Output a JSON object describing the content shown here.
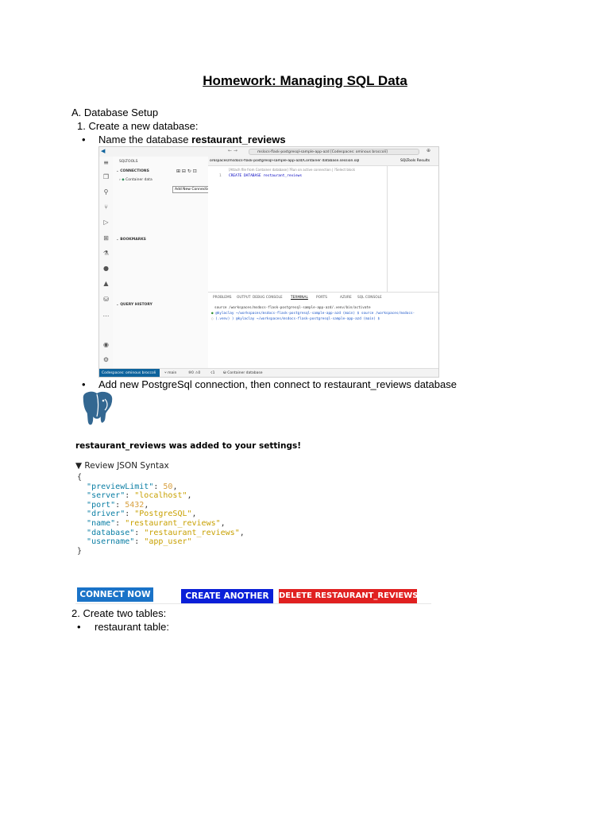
{
  "doc": {
    "title": "Homework: Managing SQL Data",
    "section_a": "A.  Database Setup",
    "step1": "1.  Create a new database:",
    "bullet1_prefix": "Name the database ",
    "bullet1_bold": "restaurant_reviews",
    "bullet2": "Add new PostgreSql connection, then connect to restaurant_reviews database",
    "step2": "2.   Create two tables:",
    "bullet3": "restaurant table:"
  },
  "vscode": {
    "search_text": "mslocs-flask-postgresql-sample-app-azd [Codespaces: ominous broccoli]",
    "sidebar": {
      "title": "SQLTOOLS",
      "connections": "CONNECTIONS",
      "container_db": "Container data",
      "tooltip": "Add New Connection",
      "bookmarks": "BOOKMARKS",
      "query_history": "QUERY HISTORY"
    },
    "editor": {
      "tab_path": "orkspaces/msdocs-flask-postgresql-sample-app-azd/Container database.session.sql",
      "results_tab": "SQLTools Results",
      "hint": "[Attach file from Container database] ?Run on active connection | ?Select block",
      "line_no": "1",
      "code": "CREATE DATABASE restaurant_reviews"
    },
    "panel": {
      "tabs": [
        "PROBLEMS",
        "OUTPUT",
        "DEBUG CONSOLE",
        "TERMINAL",
        "PORTS",
        "AZURE",
        "SQL CONSOLE"
      ],
      "line1": "source /workspaces/msdocs-flask-postgresql-sample-app-azd/.venv/bin/activate",
      "line2": "@kylaclay →/workspaces/msdocs-flask-postgresql-sample-app-azd (main) $ source /workspaces/msdocs-",
      "line3": "(.venv) ) @kylaclay →/workspaces/msdocs-flask-postgresql-sample-app-azd (main) $ "
    },
    "status": {
      "remote": "Codespaces: ominous broccoli",
      "branch": "main",
      "counts": "⑨0 ⚠0",
      "ports": "☇1",
      "db": "Container database"
    }
  },
  "settings": {
    "added_msg": "restaurant_reviews was added to your settings!",
    "review_label": "▼ Review JSON Syntax",
    "json": {
      "previewLimit": "50",
      "server": "\"localhost\"",
      "port": "5432",
      "driver": "\"PostgreSQL\"",
      "name": "\"restaurant_reviews\"",
      "database": "\"restaurant_reviews\"",
      "username": "\"app_user\""
    }
  },
  "buttons": {
    "connect": "CONNECT NOW",
    "create": "CREATE ANOTHER",
    "delete": "DELETE RESTAURANT_REVIEWS"
  },
  "colors": {
    "connect": "#1a73c8",
    "create": "#0a1fd8",
    "delete": "#e02020",
    "postgres_blue": "#336791"
  }
}
